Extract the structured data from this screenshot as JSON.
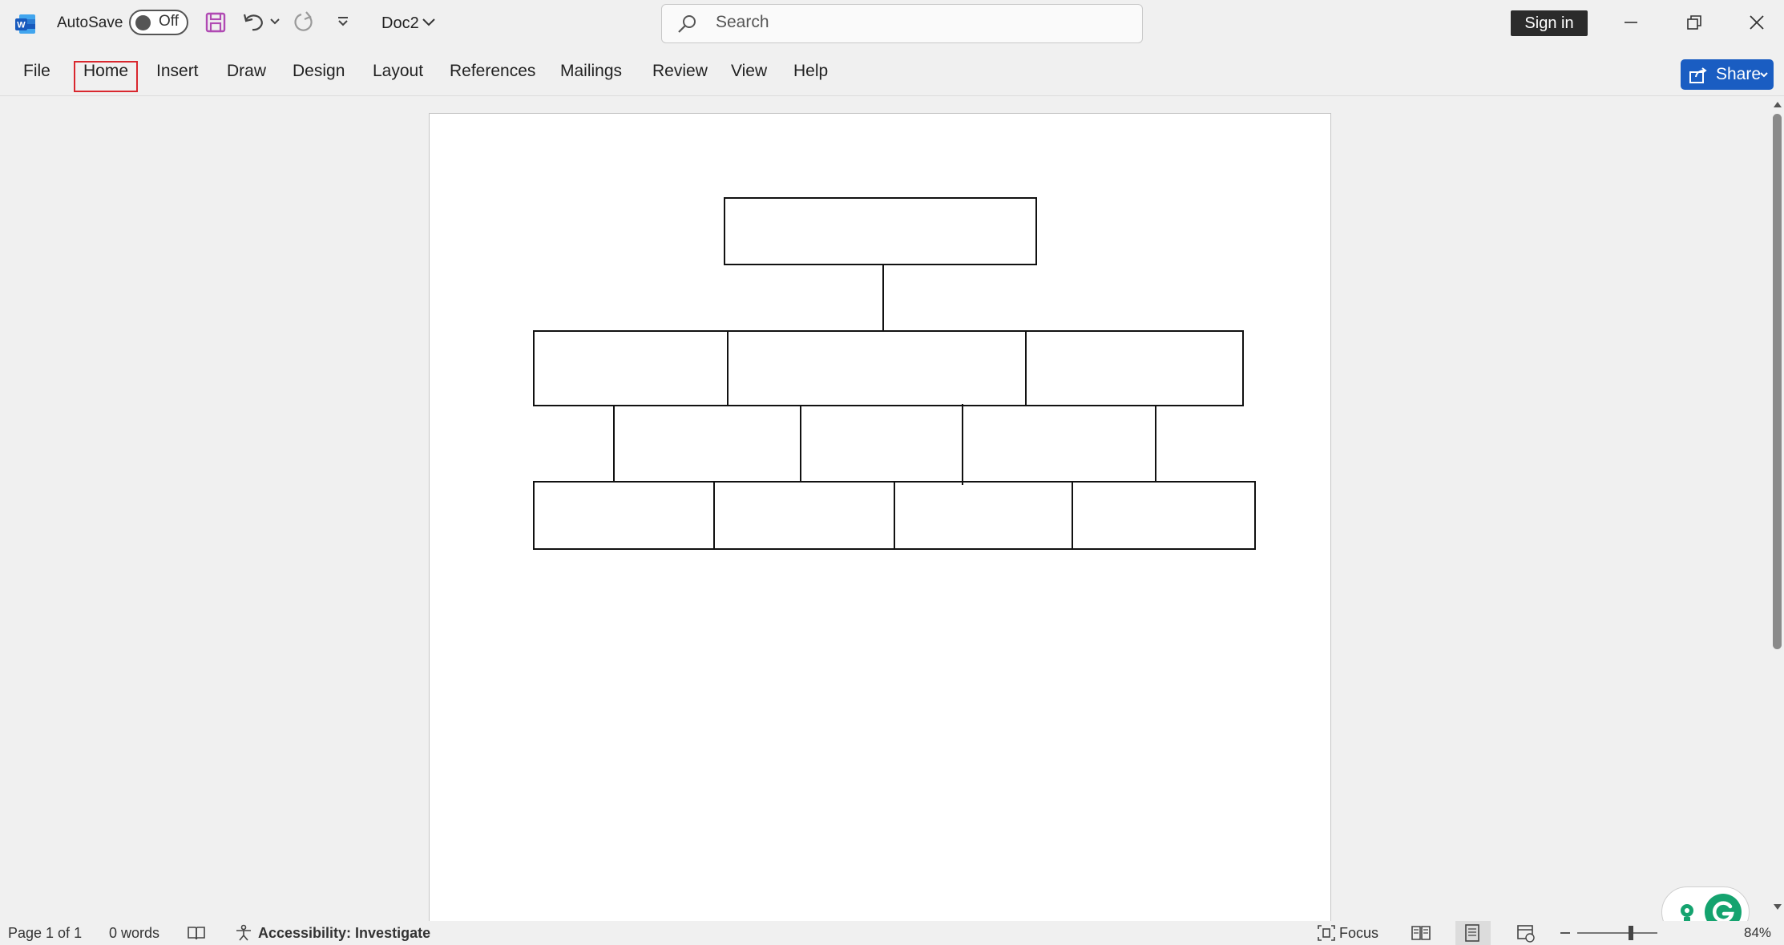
{
  "titlebar": {
    "autosave_label": "AutoSave",
    "autosave_state": "Off",
    "doc_name": "Doc2",
    "search_placeholder": "Search",
    "signin_label": "Sign in"
  },
  "menu": {
    "items": [
      "File",
      "Home",
      "Insert",
      "Draw",
      "Design",
      "Layout",
      "References",
      "Mailings",
      "Review",
      "View",
      "Help"
    ],
    "selected": "Home",
    "share_label": "Share"
  },
  "status": {
    "page": "Page 1 of 1",
    "words": "0 words",
    "accessibility": "Accessibility: Investigate",
    "focus": "Focus",
    "zoom": "84%"
  },
  "colors": {
    "accent": "#1a5dc2",
    "highlight": "#d9272e",
    "word_blue": "#185abd"
  }
}
